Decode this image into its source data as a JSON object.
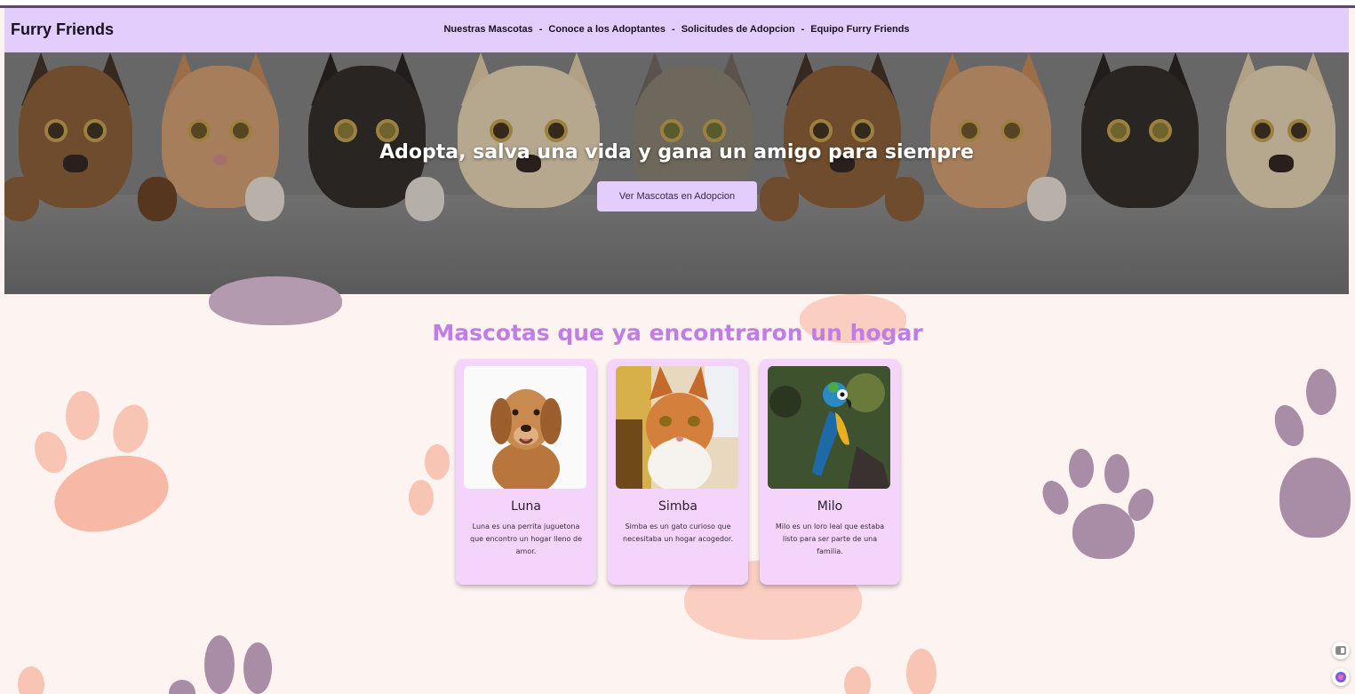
{
  "brand": "Furry Friends",
  "nav": {
    "items": [
      "Nuestras Mascotas",
      "Conoce a los Adoptantes",
      "Solicitudes de Adopcion",
      "Equipo Furry Friends"
    ],
    "separator": "-"
  },
  "hero": {
    "title": "Adopta, salva una vida y gana un amigo para siempre",
    "button_label": "Ver Mascotas en Adopcion"
  },
  "section": {
    "title": "Mascotas que ya encontraron un hogar"
  },
  "pets": [
    {
      "name": "Luna",
      "description": "Luna es una perrita juguetona que encontro un hogar lleno de amor.",
      "image": "golden-retriever"
    },
    {
      "name": "Simba",
      "description": "Simba es un gato curioso que necesitaba un hogar acogedor.",
      "image": "orange-cat"
    },
    {
      "name": "Milo",
      "description": "Milo es un loro leal que estaba listo para ser parte de una familia.",
      "image": "blue-parrot"
    }
  ],
  "colors": {
    "navbar": "#e3cdfc",
    "accent_title": "#c17de6",
    "card_bg": "#f5d4fb",
    "page_bg": "#fdf4f1",
    "paw_pink": "#f8bfb0",
    "paw_purple": "#a98ca5"
  }
}
